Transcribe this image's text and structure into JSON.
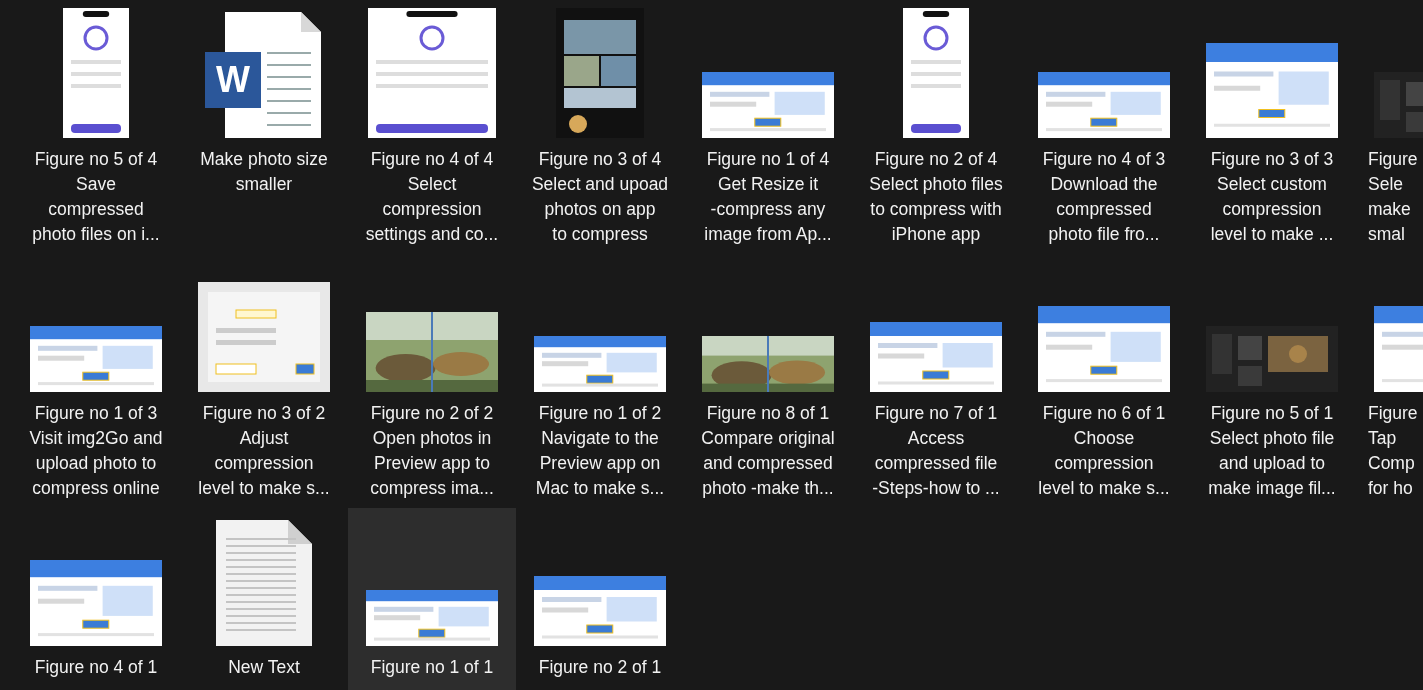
{
  "items": [
    {
      "kind": "phone",
      "selected": false,
      "caption": [
        "Figure no 5 of 4",
        "Save",
        "compressed",
        "photo files on i..."
      ]
    },
    {
      "kind": "word",
      "badge": "W",
      "selected": false,
      "caption": [
        "Make photo size",
        "smaller"
      ]
    },
    {
      "kind": "phone-wide",
      "selected": false,
      "caption": [
        "Figure no 4 of 4",
        "Select",
        "compression",
        "settings and co..."
      ]
    },
    {
      "kind": "dark-phone",
      "selected": false,
      "caption": [
        "Figure no 3 of 4",
        "Select and upoad",
        "photos on app",
        "to compress"
      ]
    },
    {
      "kind": "screen",
      "selected": false,
      "caption": [
        "Figure no 1 of 4",
        "Get Resize it",
        "-compress any",
        "image from Ap..."
      ]
    },
    {
      "kind": "phone",
      "selected": false,
      "caption": [
        "Figure no 2 of 4",
        "Select photo files",
        "to compress with",
        "iPhone app"
      ]
    },
    {
      "kind": "screen",
      "selected": false,
      "caption": [
        "Figure no 4 of 3",
        "Download the",
        "compressed",
        "photo file fro..."
      ]
    },
    {
      "kind": "screen-tall",
      "selected": false,
      "caption": [
        "Figure no 3 of 3",
        "Select custom",
        "compression",
        "level to make ..."
      ]
    },
    {
      "kind": "dark",
      "selected": false,
      "caption": [
        "Figure",
        "Sele",
        "make",
        "smal"
      ]
    },
    {
      "kind": "screen",
      "selected": false,
      "caption": [
        "Figure no 1 of 3",
        "Visit img2Go and",
        "upload photo to",
        "compress online"
      ]
    },
    {
      "kind": "dialog",
      "selected": false,
      "caption": [
        "Figure no 3 of 2",
        "Adjust",
        "compression",
        "level to make s..."
      ]
    },
    {
      "selected": false,
      "caption": [
        "Figure no 2 of 2",
        "Open photos in",
        "Preview app to",
        "compress ima..."
      ]
    },
    {
      "kind": "screen-short",
      "selected": false,
      "caption": [
        "Figure no 1 of 2",
        "Navigate to the",
        "Preview app on",
        "Mac to make s..."
      ]
    },
    {
      "kind": "photo-short",
      "selected": false,
      "caption": [
        "Figure no 8 of 1",
        "Compare original",
        "and compressed",
        "photo -make th..."
      ]
    },
    {
      "kind": "screen-mid",
      "selected": false,
      "caption": [
        "Figure no 7 of 1",
        "Access",
        "compressed file",
        "-Steps-how to ..."
      ]
    },
    {
      "kind": "screen-big",
      "selected": false,
      "caption": [
        "Figure no 6 of 1",
        "Choose",
        "compression",
        "level to make s..."
      ]
    },
    {
      "kind": "dark",
      "selected": false,
      "caption": [
        "Figure no 5 of 1",
        "Select photo file",
        "and upload to",
        "make image fil..."
      ]
    },
    {
      "kind": "screen-big",
      "selected": false,
      "caption": [
        "Figure",
        "Tap",
        "Comp",
        "for ho"
      ]
    },
    {
      "kind": "screen-big",
      "selected": false,
      "caption": [
        "Figure no 4 of 1"
      ]
    },
    {
      "kind": "text",
      "selected": false,
      "caption": [
        "New Text"
      ]
    },
    {
      "kind": "screen-short",
      "selected": true,
      "caption": [
        "Figure no 1 of 1"
      ]
    },
    {
      "kind": "screen-mid",
      "selected": false,
      "caption": [
        "Figure no 2 of 1"
      ]
    }
  ]
}
